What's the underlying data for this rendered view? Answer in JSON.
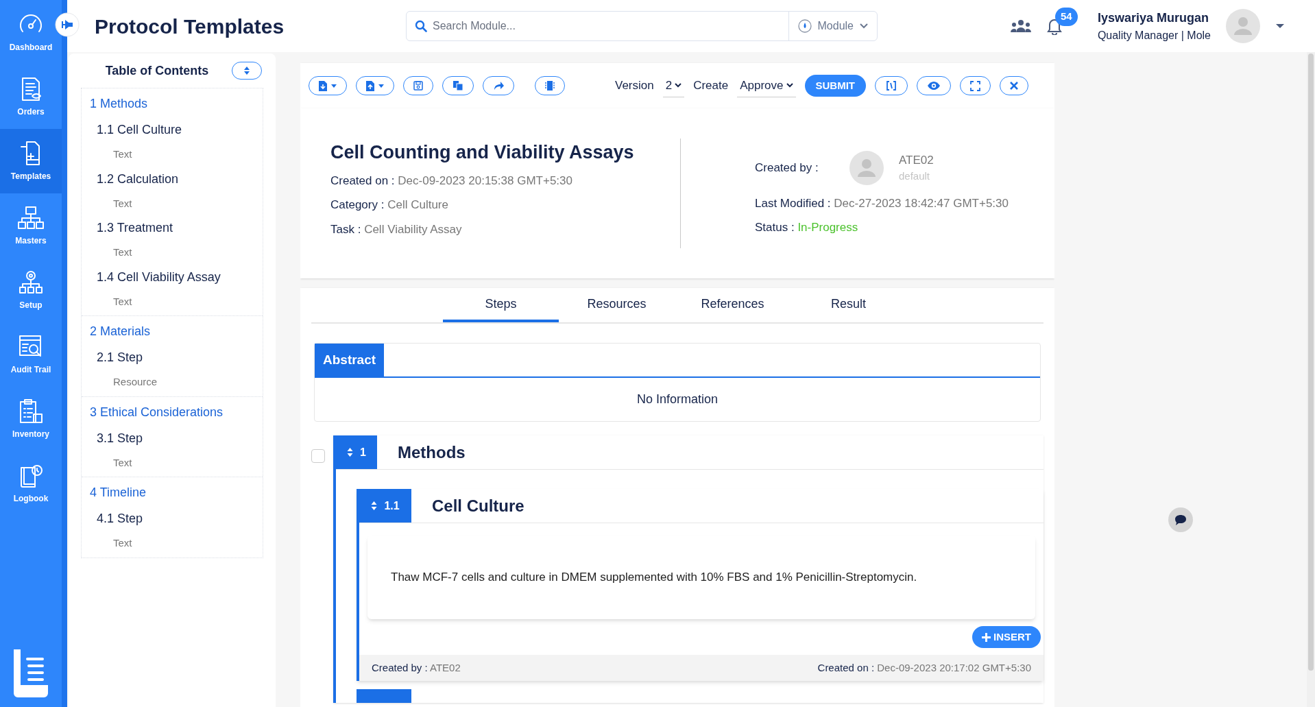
{
  "sidebar": {
    "items": [
      {
        "label": "Dashboard",
        "selected": false
      },
      {
        "label": "Orders",
        "selected": false
      },
      {
        "label": "Templates",
        "selected": true
      },
      {
        "label": "Masters",
        "selected": false
      },
      {
        "label": "Setup",
        "selected": false
      },
      {
        "label": "Audit Trail",
        "selected": false
      },
      {
        "label": "Inventory",
        "selected": false
      },
      {
        "label": "Logbook",
        "selected": false
      }
    ]
  },
  "header": {
    "title": "Protocol Templates",
    "search": {
      "placeholder": "Search Module..."
    },
    "module_select": "Module",
    "notifications": "54",
    "user": {
      "name": "Iyswariya Murugan",
      "role": "Quality Manager | Mole"
    }
  },
  "toc": {
    "title": "Table of Contents",
    "sections": [
      {
        "label": "1 Methods",
        "children": [
          {
            "label": "1.1 Cell Culture",
            "children": [
              {
                "label": "Text"
              }
            ]
          },
          {
            "label": "1.2 Calculation",
            "children": [
              {
                "label": "Text"
              }
            ]
          },
          {
            "label": "1.3 Treatment",
            "children": [
              {
                "label": "Text"
              }
            ]
          },
          {
            "label": "1.4 Cell Viability Assay",
            "children": [
              {
                "label": "Text"
              }
            ]
          }
        ]
      },
      {
        "label": "2 Materials",
        "children": [
          {
            "label": "2.1 Step",
            "children": [
              {
                "label": "Resource"
              }
            ]
          }
        ]
      },
      {
        "label": "3 Ethical Considerations",
        "children": [
          {
            "label": "3.1 Step",
            "children": [
              {
                "label": "Text"
              }
            ]
          }
        ]
      },
      {
        "label": "4 Timeline",
        "children": [
          {
            "label": "4.1 Step",
            "children": [
              {
                "label": "Text"
              }
            ]
          }
        ]
      }
    ]
  },
  "toolbar": {
    "version_label": "Version",
    "version": "2",
    "create_label": "Create",
    "action": "Approve",
    "submit": "SUBMIT"
  },
  "template": {
    "title": "Cell Counting and Viability Assays",
    "fields": [
      {
        "label": "Created on :",
        "value": "Dec-09-2023 20:15:38 GMT+5:30"
      },
      {
        "label": "Category :",
        "value": "Cell Culture"
      },
      {
        "label": "Task :",
        "value": "Cell Viability Assay"
      }
    ],
    "created_by": {
      "label": "Created by :",
      "name": "ATE02",
      "group": "default"
    },
    "last_modified": {
      "label": "Last Modified :",
      "value": "Dec-27-2023 18:42:47 GMT+5:30"
    },
    "status": {
      "label": "Status :",
      "value": "In-Progress"
    }
  },
  "tabs": [
    {
      "label": "Steps",
      "selected": true
    },
    {
      "label": "Resources",
      "selected": false
    },
    {
      "label": "References",
      "selected": false
    },
    {
      "label": "Result",
      "selected": false
    }
  ],
  "abstract": {
    "title": "Abstract",
    "body": "No Information"
  },
  "sections": [
    {
      "number": "1",
      "title": "Methods",
      "checked": false,
      "steps": [
        {
          "number": "1.1",
          "title": "Cell Culture",
          "body": "Thaw MCF-7 cells and culture in DMEM supplemented with 10% FBS and 1% Penicillin-Streptomycin.",
          "insert": "INSERT",
          "created_by_label": "Created by :",
          "created_by": "ATE02",
          "created_on_label": "Created on :",
          "created_on": "Dec-09-2023 20:17:02 GMT+5:30"
        }
      ]
    }
  ]
}
